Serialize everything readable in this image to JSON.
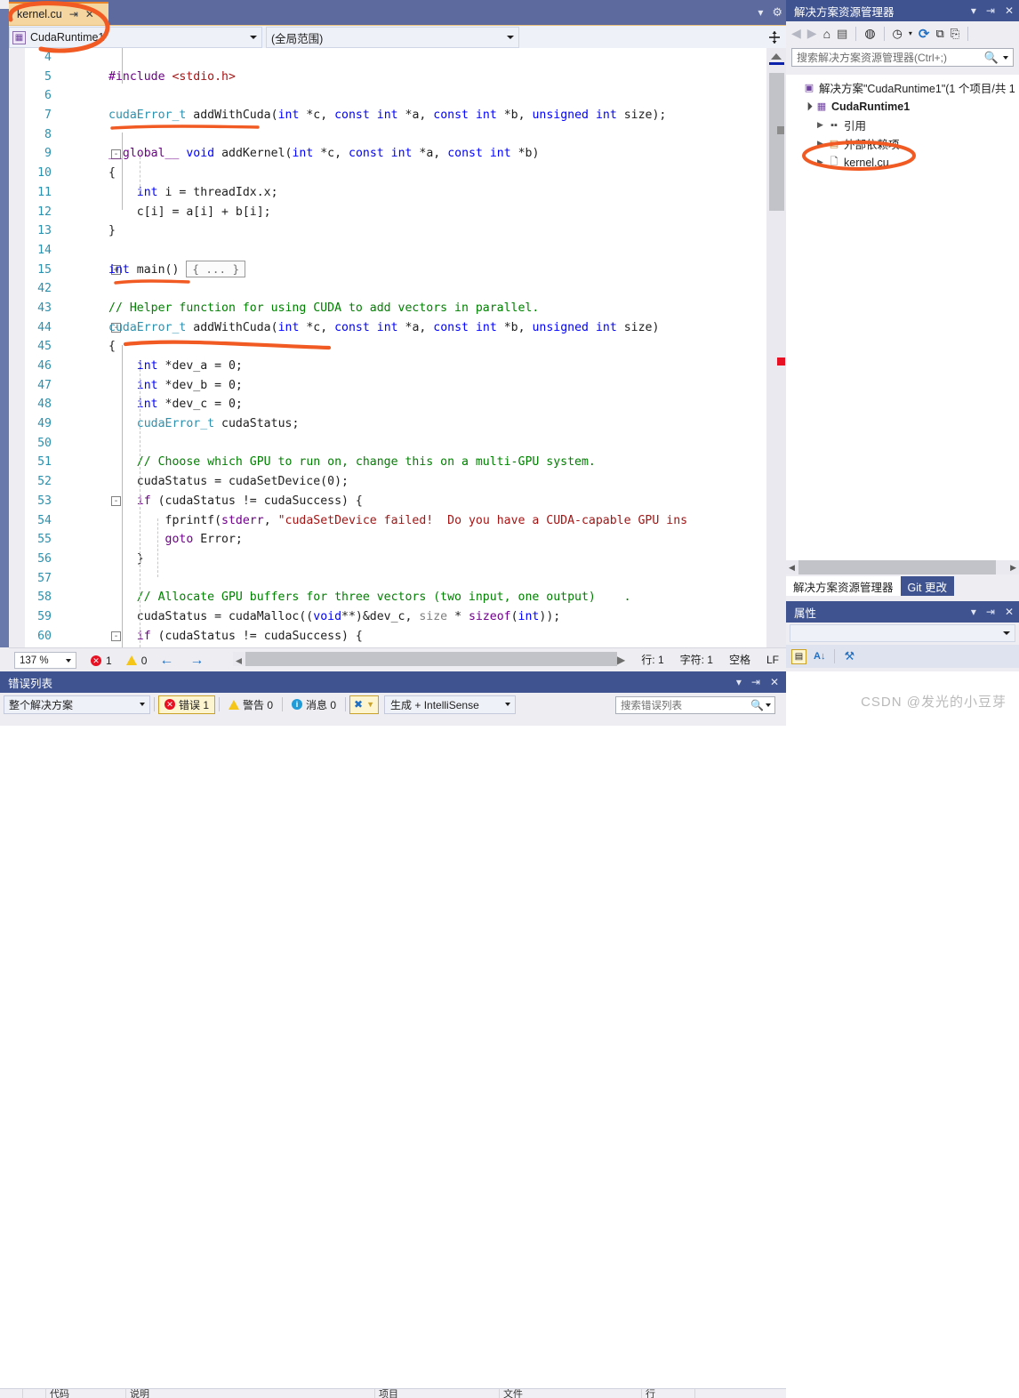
{
  "editor": {
    "tab": {
      "title": "kernel.cu",
      "pin_icon": "pin-icon",
      "close_icon": "close-icon"
    },
    "tab_tools": {
      "dropdown_icon": "chevron-down-icon",
      "settings_icon": "gear-icon"
    },
    "navbar": {
      "scope_value": "CudaRuntime1",
      "member_value": "(全局范围)",
      "splitter_icon": "split-window-icon"
    },
    "lines": [
      {
        "num": "4",
        "fold": "",
        "html": ""
      },
      {
        "num": "5",
        "fold": "",
        "html": "<span class=\"pre\">#include</span> <span class=\"inc\">&lt;stdio.h&gt;</span>"
      },
      {
        "num": "6",
        "fold": "",
        "html": ""
      },
      {
        "num": "7",
        "fold": "",
        "html": "<span class=\"typ\">cudaError_t</span> addWithCuda(<span class=\"k\">int</span> *c, <span class=\"k\">const</span> <span class=\"k\">int</span> *a, <span class=\"k\">const</span> <span class=\"k\">int</span> *b, <span class=\"k\">unsigned</span> <span class=\"k\">int</span> size);"
      },
      {
        "num": "8",
        "fold": "",
        "html": ""
      },
      {
        "num": "9",
        "fold": "-",
        "html": "<span class=\"kw\">__global__</span> <span class=\"k\">void</span> addKernel(<span class=\"k\">int</span> *c, <span class=\"k\">const</span> <span class=\"k\">int</span> *a, <span class=\"k\">const</span> <span class=\"k\">int</span> *b)"
      },
      {
        "num": "10",
        "fold": "",
        "html": "{"
      },
      {
        "num": "11",
        "fold": "",
        "html": "    <span class=\"k\">int</span> i = threadIdx.x;"
      },
      {
        "num": "12",
        "fold": "",
        "html": "    c[i] = a[i] + b[i];"
      },
      {
        "num": "13",
        "fold": "",
        "html": "}"
      },
      {
        "num": "14",
        "fold": "",
        "html": ""
      },
      {
        "num": "15",
        "fold": "+",
        "html": "<span class=\"k\">int</span> main() <span class=\"collapsed\">{ ... }</span>"
      },
      {
        "num": "42",
        "fold": "",
        "html": ""
      },
      {
        "num": "43",
        "fold": "",
        "html": "<span class=\"cmt\">// Helper function for using CUDA to add vectors in parallel.</span>"
      },
      {
        "num": "44",
        "fold": "-",
        "html": "<span class=\"typ\">cudaError_t</span> addWithCuda(<span class=\"k\">int</span> *c, <span class=\"k\">const</span> <span class=\"k\">int</span> *a, <span class=\"k\">const</span> <span class=\"k\">int</span> *b, <span class=\"k\">unsigned</span> <span class=\"k\">int</span> size)"
      },
      {
        "num": "45",
        "fold": "",
        "html": "{"
      },
      {
        "num": "46",
        "fold": "",
        "html": "    <span class=\"k\">int</span> *dev_a = 0;"
      },
      {
        "num": "47",
        "fold": "",
        "html": "    <span class=\"k\">int</span> *dev_b = 0;"
      },
      {
        "num": "48",
        "fold": "",
        "html": "    <span class=\"k\">int</span> *dev_c = 0;"
      },
      {
        "num": "49",
        "fold": "",
        "html": "    <span class=\"typ\">cudaError_t</span> cudaStatus;"
      },
      {
        "num": "50",
        "fold": "",
        "html": ""
      },
      {
        "num": "51",
        "fold": "",
        "html": "    <span class=\"cmt\">// Choose which GPU to run on, change this on a multi-GPU system.</span>"
      },
      {
        "num": "52",
        "fold": "",
        "html": "    cudaStatus = cudaSetDevice(0);"
      },
      {
        "num": "53",
        "fold": "-",
        "html": "    <span class=\"kw\">if</span> (cudaStatus != cudaSuccess) {"
      },
      {
        "num": "54",
        "fold": "",
        "html": "        fprintf(<span class=\"kw\">stderr</span>, <span class=\"str\">\"cudaSetDevice failed!  Do you have a CUDA-capable GPU ins</span>"
      },
      {
        "num": "55",
        "fold": "",
        "html": "        <span class=\"kw\">goto</span> Error;"
      },
      {
        "num": "56",
        "fold": "",
        "html": "    }"
      },
      {
        "num": "57",
        "fold": "",
        "html": ""
      },
      {
        "num": "58",
        "fold": "",
        "html": "    <span class=\"cmt\">// Allocate GPU buffers for three vectors (two input, one output)    .</span>"
      },
      {
        "num": "59",
        "fold": "",
        "html": "    cudaStatus = cudaMalloc((<span class=\"k\">void</span>**)&amp;dev_c, <span class=\"gray\">size</span> * <span class=\"kw\">sizeof</span>(<span class=\"k\">int</span>));"
      },
      {
        "num": "60",
        "fold": "-",
        "html": "    <span class=\"kw\">if</span> (cudaStatus != cudaSuccess) {"
      }
    ],
    "status": {
      "zoom": "137 %",
      "error_count": "1",
      "warning_count": "0",
      "prev_icon": "arrow-left-icon",
      "next_icon": "arrow-right-icon",
      "line_label": "行: 1",
      "char_label": "字符: 1",
      "spaces_label": "空格",
      "eol_label": "LF"
    }
  },
  "solution_explorer": {
    "title": "解决方案资源管理器",
    "title_icons": {
      "dropdown": "chevron-down-icon",
      "pin": "pin-icon",
      "close": "close-icon"
    },
    "toolbar": [
      {
        "name": "back-icon",
        "glyph": "◁"
      },
      {
        "name": "forward-icon",
        "glyph": "▷"
      },
      {
        "name": "home-icon",
        "glyph": "⌂"
      },
      {
        "name": "switch-views-icon",
        "glyph": "▤"
      },
      {
        "name": "show-all-files-icon",
        "glyph": "◍"
      },
      {
        "name": "pending-changes-icon",
        "glyph": "◷"
      },
      {
        "name": "refresh-icon",
        "glyph": "⟳"
      },
      {
        "name": "collapse-all-icon",
        "glyph": "⧉"
      },
      {
        "name": "properties-icon",
        "glyph": "⎘"
      }
    ],
    "search_placeholder": "搜索解决方案资源管理器(Ctrl+;)",
    "tree": [
      {
        "indent": 0,
        "expander": "",
        "icon": "solution-icon",
        "label": "解决方案\"CudaRuntime1\"(1 个项目/共 1",
        "bold": false
      },
      {
        "indent": 1,
        "expander": "▲",
        "icon": "project-icon",
        "label": "CudaRuntime1",
        "bold": true
      },
      {
        "indent": 2,
        "expander": "▶",
        "icon": "references-icon",
        "label": "引用",
        "bold": false
      },
      {
        "indent": 2,
        "expander": "▶",
        "icon": "folder-icon",
        "label": "外部依赖项",
        "bold": false
      },
      {
        "indent": 2,
        "expander": "▶",
        "icon": "file-icon",
        "label": "kernel.cu",
        "bold": false
      }
    ],
    "dock_tabs": [
      {
        "label": "解决方案资源管理器",
        "active": true
      },
      {
        "label": "Git 更改",
        "active": false
      }
    ]
  },
  "properties": {
    "title": "属性",
    "title_icons": {
      "dropdown": "chevron-down-icon",
      "pin": "pin-icon",
      "close": "close-icon"
    },
    "object_combo_value": "",
    "toolbar": [
      {
        "name": "categorized-icon",
        "glyph": "▦"
      },
      {
        "name": "alphabetical-icon",
        "glyph": "A↓"
      },
      {
        "name": "property-pages-icon",
        "glyph": "🔧"
      }
    ]
  },
  "error_list": {
    "title": "错误列表",
    "title_icons": {
      "dropdown": "chevron-down-icon",
      "pin": "pin-icon",
      "close": "close-icon"
    },
    "scope_value": "整个解决方案",
    "errors_label": "错误 1",
    "warnings_label": "警告 0",
    "messages_label": "消息 0",
    "filter_icon": "clear-filter-icon",
    "build_filter_value": "生成 + IntelliSense",
    "search_placeholder": "搜索错误列表",
    "columns": [
      "",
      "",
      "代码",
      "说明",
      "项目",
      "文件",
      "行"
    ]
  },
  "watermark": "CSDN @发光的小豆芽",
  "colors": {
    "chrome_blue": "#3f5390",
    "tab_strip": "#5c6a9e",
    "active_tab": "#f5d6a0",
    "active_tab_border": "#e8842a",
    "annotation_orange": "#f15a22",
    "error_red": "#e81123",
    "warning_yellow": "#f5c518",
    "line_number": "#2b91af",
    "keyword_blue": "#0000ff",
    "keyword_purple": "#6f008a",
    "comment_green": "#008000",
    "string_red": "#a31515",
    "type_teal": "#2b91af"
  }
}
